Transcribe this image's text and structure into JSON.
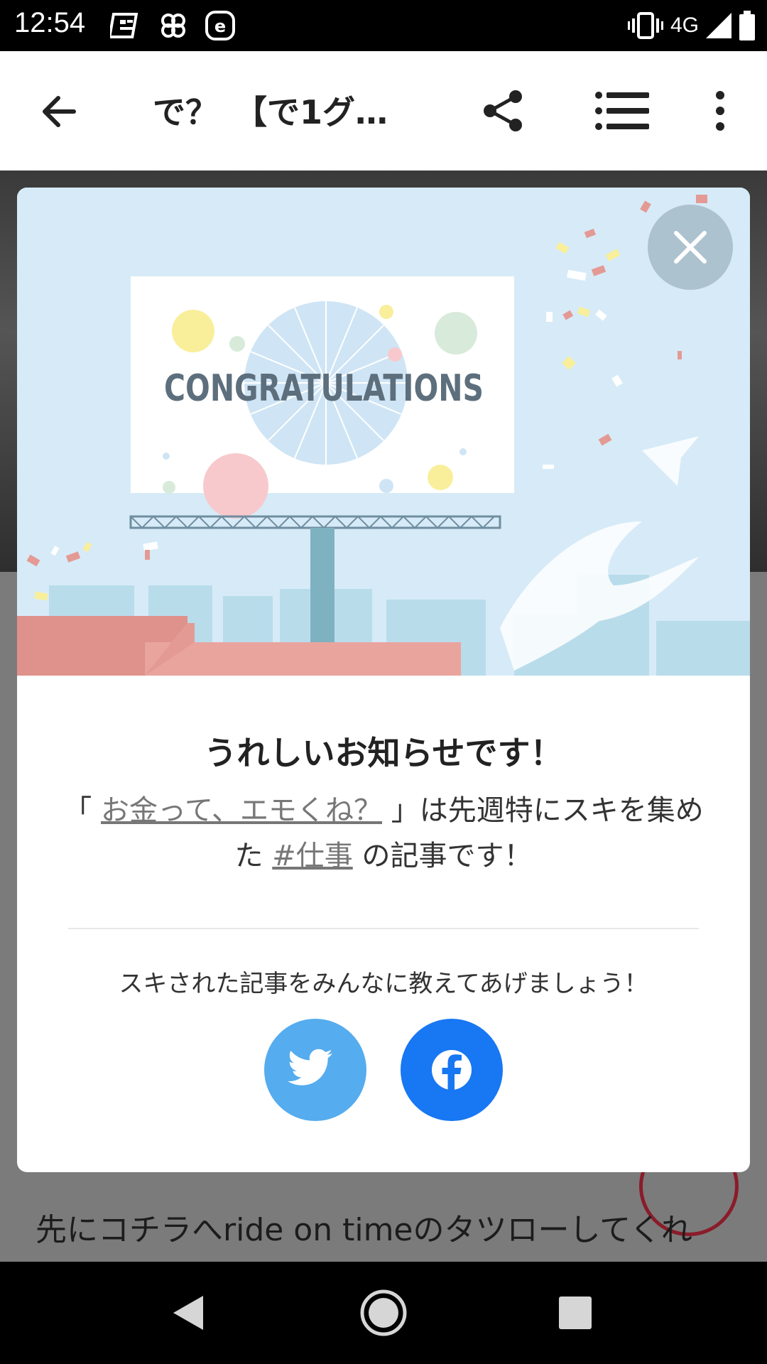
{
  "status_bar": {
    "time": "12:54",
    "notification_icons": [
      "newspaper-app-icon",
      "pinwheel-app-icon",
      "e-app-icon"
    ],
    "network": "4G",
    "icons": [
      "vibrate-icon",
      "signal-icon",
      "battery-icon"
    ]
  },
  "app_bar": {
    "title": "で？　【で1グ…"
  },
  "background": {
    "text": "先にコチラへride on timeのタツローしてくれ"
  },
  "modal": {
    "illustration_text": "CONGRATULATIONS",
    "heading": "うれしいお知らせです！",
    "message": {
      "open_quote": "「",
      "article_link": "お金って、エモくね？",
      "middle": "」は先週特にスキを集めた",
      "tag_link": "#仕事",
      "end": "の記事です！"
    },
    "share_prompt": "スキされた記事をみんなに教えてあげましょう！",
    "share_buttons": [
      "twitter-icon",
      "facebook-icon"
    ],
    "colors": {
      "twitter": "#55acee",
      "facebook": "#1877f2",
      "sky": "#d6ebf7",
      "roof": "#e7a29b"
    }
  }
}
